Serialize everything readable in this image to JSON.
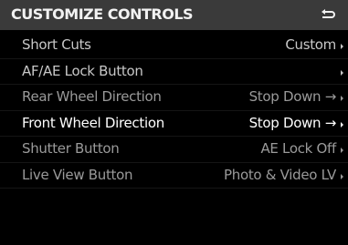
{
  "header": {
    "title": "CUSTOMIZE CONTROLS",
    "back_icon": "return-icon"
  },
  "menu": {
    "selected_index": 3,
    "items": [
      {
        "label": "Short Cuts",
        "value": "Custom"
      },
      {
        "label": "AF/AE Lock Button",
        "value": ""
      },
      {
        "label": "Rear Wheel Direction",
        "value": "Stop Down →"
      },
      {
        "label": "Front Wheel Direction",
        "value": "Stop Down →"
      },
      {
        "label": "Shutter Button",
        "value": "AE Lock Off"
      },
      {
        "label": "Live View Button",
        "value": "Photo & Video LV"
      }
    ]
  },
  "colors": {
    "header_bg": "#3a3a3a",
    "screen_bg": "#000000",
    "text_dim": "#9a9a9a",
    "text_selected": "#ffffff"
  }
}
